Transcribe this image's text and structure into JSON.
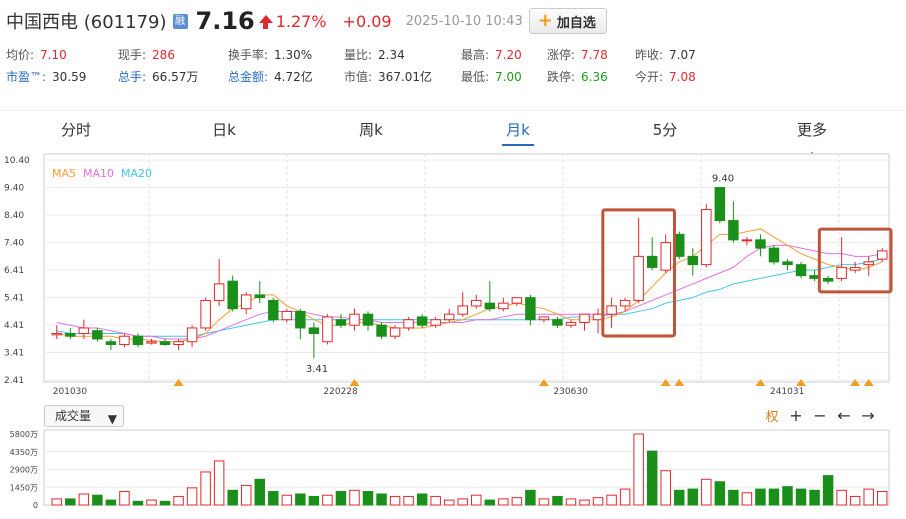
{
  "header": {
    "name": "中国西电",
    "code": "(601179)",
    "badge": "融",
    "price": "7.16",
    "pct": "1.27%",
    "change": "+0.09",
    "timestamp": "2025-10-10 10:43",
    "add_button": "加自选"
  },
  "stats": [
    {
      "label": "均价:",
      "value": "7.10",
      "color": "red"
    },
    {
      "label": "现手:",
      "value": "286",
      "color": "red"
    },
    {
      "label": "换手率:",
      "value": "1.30%",
      "color": "dark"
    },
    {
      "label": "量比:",
      "value": "2.34",
      "color": "dark"
    },
    {
      "label": "最高:",
      "value": "7.20",
      "color": "red"
    },
    {
      "label": "涨停:",
      "value": "7.78",
      "color": "red"
    },
    {
      "label": "昨收:",
      "value": "7.07",
      "color": "dark"
    },
    {
      "label": "市盈™:",
      "value": "30.59",
      "color": "dark",
      "blue": true
    },
    {
      "label": "总手:",
      "value": "66.57万",
      "color": "dark",
      "blue": true
    },
    {
      "label": "总金额:",
      "value": "4.72亿",
      "color": "dark",
      "blue": true
    },
    {
      "label": "市值:",
      "value": "367.01亿",
      "color": "dark"
    },
    {
      "label": "最低:",
      "value": "7.00",
      "color": "green"
    },
    {
      "label": "跌停:",
      "value": "6.36",
      "color": "green"
    },
    {
      "label": "今开:",
      "value": "7.08",
      "color": "red"
    }
  ],
  "tabs": [
    {
      "label": "分时"
    },
    {
      "label": "日k"
    },
    {
      "label": "周k"
    },
    {
      "label": "月k"
    },
    {
      "label": "5分"
    },
    {
      "label": "更多"
    }
  ],
  "active_tab": "月k",
  "more_icon": "vertical-dots-icon",
  "colors": {
    "up": "#e0282e",
    "down": "#1a8f1a",
    "ma5": "#f0a030",
    "ma10": "#e070e0",
    "ma20": "#40c8e8",
    "highlight": "#c0543a"
  },
  "chart_data": {
    "type": "candlestick",
    "legend": [
      "MA5",
      "MA10",
      "MA20"
    ],
    "y_ticks": [
      "10.40",
      "9.40",
      "8.40",
      "7.40",
      "6.41",
      "5.41",
      "4.41",
      "3.41",
      "2.41"
    ],
    "ylim": [
      2.41,
      10.4
    ],
    "x_labels": [
      "201030",
      "220228",
      "230630",
      "241031"
    ],
    "annotations": {
      "high": "9.40",
      "low": "3.41"
    },
    "candles": [
      {
        "o": 4.05,
        "c": 4.1,
        "h": 4.4,
        "l": 3.9
      },
      {
        "o": 4.1,
        "c": 4.0,
        "h": 4.3,
        "l": 3.9
      },
      {
        "o": 4.1,
        "c": 4.3,
        "h": 4.6,
        "l": 3.9
      },
      {
        "o": 4.2,
        "c": 3.9,
        "h": 4.3,
        "l": 3.8
      },
      {
        "o": 3.8,
        "c": 3.7,
        "h": 3.9,
        "l": 3.5
      },
      {
        "o": 3.7,
        "c": 4.0,
        "h": 4.1,
        "l": 3.6
      },
      {
        "o": 4.0,
        "c": 3.7,
        "h": 4.1,
        "l": 3.6
      },
      {
        "o": 3.75,
        "c": 3.8,
        "h": 3.9,
        "l": 3.7
      },
      {
        "o": 3.8,
        "c": 3.7,
        "h": 3.9,
        "l": 3.65
      },
      {
        "o": 3.7,
        "c": 3.8,
        "h": 3.9,
        "l": 3.5
      },
      {
        "o": 3.8,
        "c": 4.3,
        "h": 4.4,
        "l": 3.6
      },
      {
        "o": 4.3,
        "c": 5.3,
        "h": 5.4,
        "l": 4.2
      },
      {
        "o": 5.3,
        "c": 5.9,
        "h": 6.8,
        "l": 5.1
      },
      {
        "o": 6.0,
        "c": 5.0,
        "h": 6.2,
        "l": 4.9
      },
      {
        "o": 5.0,
        "c": 5.5,
        "h": 5.6,
        "l": 4.8
      },
      {
        "o": 5.5,
        "c": 5.4,
        "h": 6.0,
        "l": 5.2
      },
      {
        "o": 5.3,
        "c": 4.6,
        "h": 5.4,
        "l": 4.5
      },
      {
        "o": 4.6,
        "c": 4.9,
        "h": 5.0,
        "l": 4.5
      },
      {
        "o": 4.9,
        "c": 4.3,
        "h": 5.0,
        "l": 3.9
      },
      {
        "o": 4.3,
        "c": 4.1,
        "h": 4.5,
        "l": 3.2
      },
      {
        "o": 3.8,
        "c": 4.7,
        "h": 4.8,
        "l": 3.7
      },
      {
        "o": 4.6,
        "c": 4.4,
        "h": 4.8,
        "l": 4.3
      },
      {
        "o": 4.4,
        "c": 4.8,
        "h": 5.0,
        "l": 4.2
      },
      {
        "o": 4.8,
        "c": 4.4,
        "h": 4.9,
        "l": 4.2
      },
      {
        "o": 4.4,
        "c": 4.0,
        "h": 4.5,
        "l": 3.9
      },
      {
        "o": 4.0,
        "c": 4.3,
        "h": 4.4,
        "l": 3.9
      },
      {
        "o": 4.3,
        "c": 4.6,
        "h": 4.7,
        "l": 4.2
      },
      {
        "o": 4.7,
        "c": 4.4,
        "h": 4.8,
        "l": 4.3
      },
      {
        "o": 4.4,
        "c": 4.6,
        "h": 4.7,
        "l": 4.3
      },
      {
        "o": 4.6,
        "c": 4.8,
        "h": 5.0,
        "l": 4.5
      },
      {
        "o": 4.8,
        "c": 5.1,
        "h": 5.6,
        "l": 4.7
      },
      {
        "o": 5.1,
        "c": 5.3,
        "h": 5.5,
        "l": 5.0
      },
      {
        "o": 5.2,
        "c": 5.0,
        "h": 6.0,
        "l": 4.9
      },
      {
        "o": 5.0,
        "c": 5.2,
        "h": 5.4,
        "l": 4.9
      },
      {
        "o": 5.2,
        "c": 5.4,
        "h": 5.4,
        "l": 5.1
      },
      {
        "o": 5.4,
        "c": 4.6,
        "h": 5.5,
        "l": 4.4
      },
      {
        "o": 4.6,
        "c": 4.7,
        "h": 4.7,
        "l": 4.5
      },
      {
        "o": 4.6,
        "c": 4.4,
        "h": 4.7,
        "l": 4.3
      },
      {
        "o": 4.4,
        "c": 4.5,
        "h": 4.6,
        "l": 4.3
      },
      {
        "o": 4.5,
        "c": 4.8,
        "h": 4.8,
        "l": 4.2
      },
      {
        "o": 4.6,
        "c": 4.8,
        "h": 5.0,
        "l": 4.1
      },
      {
        "o": 4.8,
        "c": 5.1,
        "h": 5.4,
        "l": 4.3
      },
      {
        "o": 5.1,
        "c": 5.3,
        "h": 5.4,
        "l": 4.9
      },
      {
        "o": 5.3,
        "c": 6.9,
        "h": 8.3,
        "l": 5.2
      },
      {
        "o": 6.9,
        "c": 6.5,
        "h": 7.6,
        "l": 6.4
      },
      {
        "o": 6.4,
        "c": 7.4,
        "h": 7.7,
        "l": 6.3
      },
      {
        "o": 7.7,
        "c": 6.9,
        "h": 7.8,
        "l": 6.8
      },
      {
        "o": 6.9,
        "c": 6.6,
        "h": 7.2,
        "l": 6.2
      },
      {
        "o": 6.6,
        "c": 8.6,
        "h": 8.8,
        "l": 6.5
      },
      {
        "o": 9.4,
        "c": 8.2,
        "h": 9.4,
        "l": 8.1
      },
      {
        "o": 8.2,
        "c": 7.5,
        "h": 8.9,
        "l": 7.4
      },
      {
        "o": 7.5,
        "c": 7.5,
        "h": 7.6,
        "l": 7.3
      },
      {
        "o": 7.5,
        "c": 7.2,
        "h": 7.7,
        "l": 6.9
      },
      {
        "o": 7.2,
        "c": 6.7,
        "h": 7.3,
        "l": 6.6
      },
      {
        "o": 6.7,
        "c": 6.6,
        "h": 6.8,
        "l": 6.4
      },
      {
        "o": 6.6,
        "c": 6.2,
        "h": 6.7,
        "l": 6.1
      },
      {
        "o": 6.2,
        "c": 6.1,
        "h": 6.4,
        "l": 6.0
      },
      {
        "o": 6.1,
        "c": 6.0,
        "h": 6.2,
        "l": 5.9
      },
      {
        "o": 6.1,
        "c": 6.5,
        "h": 7.6,
        "l": 6.0
      },
      {
        "o": 6.4,
        "c": 6.5,
        "h": 6.7,
        "l": 6.3
      },
      {
        "o": 6.6,
        "c": 6.7,
        "h": 6.9,
        "l": 6.2
      },
      {
        "o": 6.8,
        "c": 7.1,
        "h": 7.2,
        "l": 6.7
      }
    ],
    "ma5": [
      4.1,
      4.0,
      4.0,
      4.0,
      4.0,
      3.9,
      3.9,
      3.85,
      3.8,
      3.8,
      3.9,
      4.1,
      4.6,
      5.0,
      5.2,
      5.5,
      5.5,
      5.1,
      4.9,
      4.6,
      4.4,
      4.4,
      4.5,
      4.5,
      4.4,
      4.3,
      4.3,
      4.3,
      4.4,
      4.5,
      4.6,
      4.8,
      5.0,
      5.1,
      5.2,
      5.1,
      5.0,
      4.8,
      4.6,
      4.6,
      4.6,
      4.7,
      4.9,
      5.3,
      5.8,
      6.3,
      6.7,
      6.9,
      7.3,
      7.7,
      7.7,
      7.8,
      7.9,
      7.6,
      7.3,
      7.0,
      6.8,
      6.6,
      6.5,
      6.4,
      6.5,
      6.7
    ],
    "ma10": [
      4.5,
      4.4,
      4.3,
      4.3,
      4.2,
      4.1,
      4.0,
      4.0,
      3.9,
      3.9,
      3.9,
      4.0,
      4.2,
      4.4,
      4.6,
      4.8,
      4.9,
      4.9,
      4.9,
      4.8,
      4.7,
      4.7,
      4.6,
      4.6,
      4.5,
      4.5,
      4.5,
      4.5,
      4.5,
      4.5,
      4.5,
      4.6,
      4.6,
      4.7,
      4.8,
      4.8,
      4.8,
      4.8,
      4.8,
      4.8,
      4.8,
      4.8,
      4.9,
      5.1,
      5.3,
      5.5,
      5.7,
      5.9,
      6.1,
      6.3,
      6.5,
      6.9,
      7.2,
      7.3,
      7.3,
      7.2,
      7.1,
      7.0,
      7.0,
      6.9,
      6.9,
      7.0
    ],
    "ma20": [
      4.2,
      4.1,
      4.1,
      4.1,
      4.1,
      4.1,
      4.0,
      4.0,
      4.0,
      4.0,
      4.0,
      4.1,
      4.2,
      4.3,
      4.4,
      4.5,
      4.6,
      4.6,
      4.6,
      4.6,
      4.6,
      4.6,
      4.6,
      4.6,
      4.6,
      4.6,
      4.6,
      4.6,
      4.6,
      4.6,
      4.6,
      4.6,
      4.6,
      4.6,
      4.6,
      4.6,
      4.6,
      4.6,
      4.7,
      4.7,
      4.7,
      4.8,
      4.8,
      4.9,
      5.0,
      5.2,
      5.3,
      5.4,
      5.6,
      5.7,
      5.9,
      6.0,
      6.1,
      6.2,
      6.3,
      6.4,
      6.4,
      6.5,
      6.6,
      6.6,
      6.7,
      6.8
    ],
    "volume_label": "成交量",
    "volume_ticks": [
      "5800万",
      "4350万",
      "2900万",
      "1450万",
      "0"
    ],
    "volume_max": 5800,
    "volumes": [
      500,
      500,
      900,
      800,
      400,
      1100,
      300,
      400,
      300,
      700,
      1400,
      2700,
      3600,
      1200,
      1600,
      2100,
      1100,
      800,
      900,
      700,
      800,
      1100,
      1200,
      1100,
      900,
      700,
      700,
      900,
      700,
      400,
      500,
      800,
      400,
      500,
      600,
      1200,
      500,
      700,
      500,
      400,
      600,
      800,
      1300,
      5800,
      4400,
      2800,
      1200,
      1300,
      2100,
      1900,
      1200,
      1000,
      1300,
      1300,
      1500,
      1300,
      1200,
      2400,
      1200,
      700,
      1300,
      1100
    ],
    "markers": [
      9,
      22,
      36,
      45,
      46,
      52,
      55,
      59,
      60
    ],
    "highlights": [
      [
        41,
        45
      ],
      [
        57,
        61
      ]
    ]
  },
  "volume_select": {
    "label": "成交量"
  },
  "tools": [
    "权",
    "+",
    "−",
    "←",
    "→"
  ]
}
